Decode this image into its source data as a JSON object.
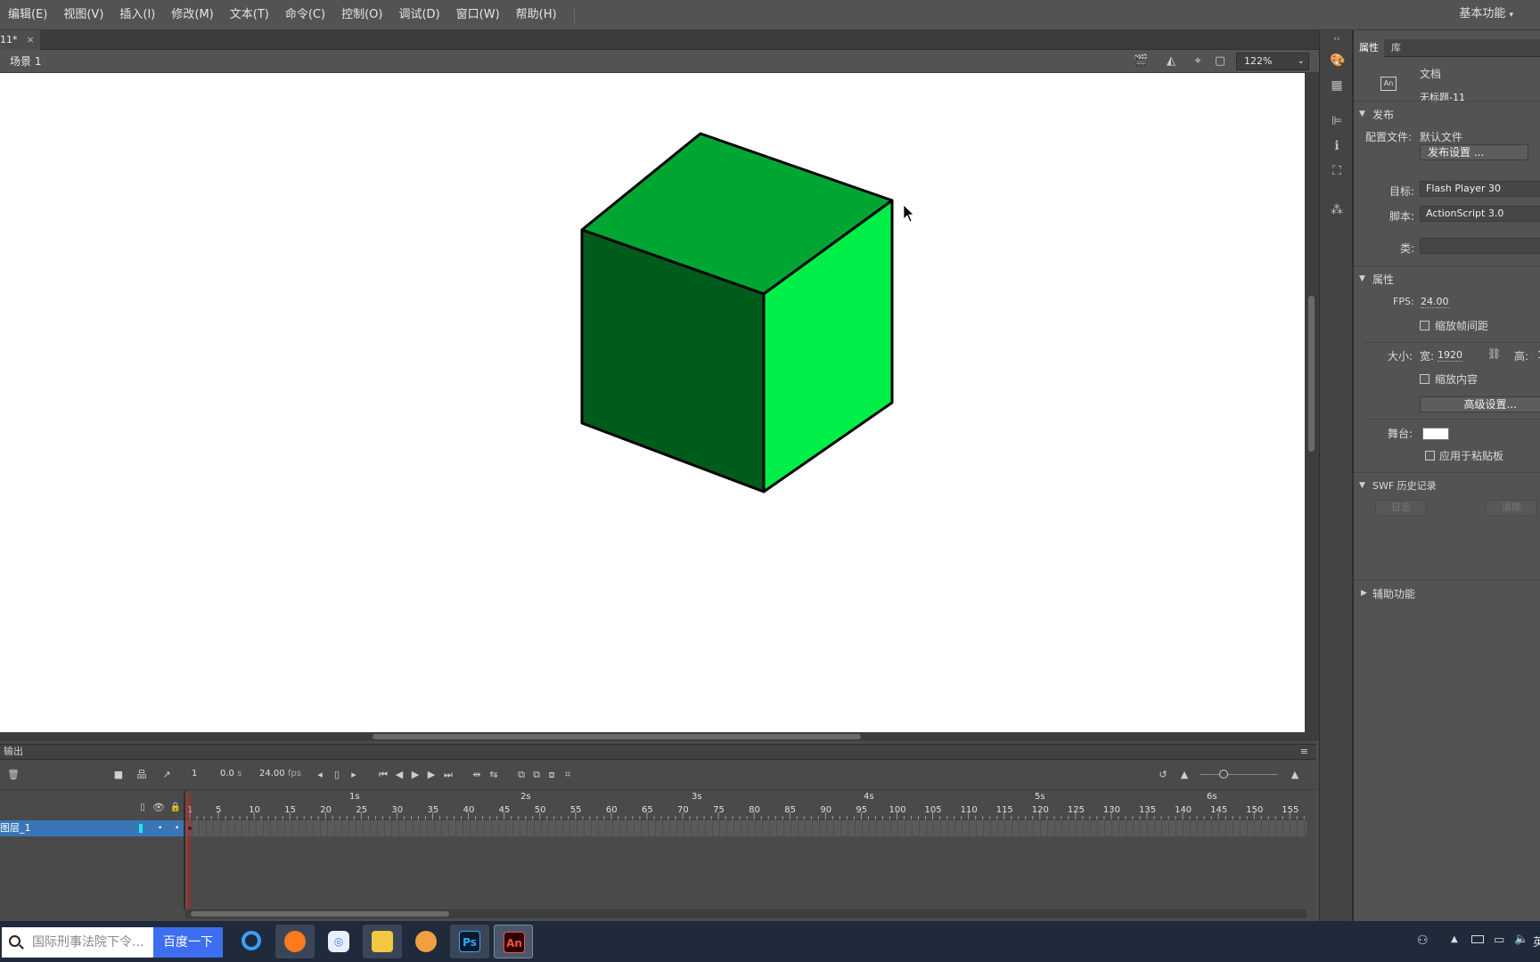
{
  "menu": [
    "编辑(E)",
    "视图(V)",
    "插入(I)",
    "修改(M)",
    "文本(T)",
    "命令(C)",
    "控制(O)",
    "调试(D)",
    "窗口(W)",
    "帮助(H)"
  ],
  "workspace": "基本功能",
  "doc_tab": {
    "title": "11*",
    "close": "×"
  },
  "scene": {
    "label": "场景 1",
    "zoom": "122%"
  },
  "output_label": "输出",
  "timeline": {
    "frame": "1",
    "time": "0.0",
    "time_unit": "s",
    "fps": "24.00",
    "fps_unit": "fps",
    "seconds": [
      "1s",
      "2s",
      "3s",
      "4s",
      "5s",
      "6s"
    ],
    "frame_ticks": [
      "1",
      "5",
      "10",
      "15",
      "20",
      "25",
      "30",
      "35",
      "40",
      "45",
      "50",
      "55",
      "60",
      "65",
      "70",
      "75",
      "80",
      "85",
      "90",
      "95",
      "100",
      "105",
      "110",
      "115",
      "120",
      "125",
      "130",
      "135",
      "140",
      "145",
      "150",
      "155"
    ],
    "layer_name": "图层_1"
  },
  "props": {
    "tab_props": "属性",
    "tab_lib": "库",
    "doc_type": "文档",
    "doc_name": "无标题-11",
    "publish_header": "发布",
    "profile_label": "配置文件:",
    "profile_value": "默认文件",
    "publish_settings_btn": "发布设置 ...",
    "target_label": "目标:",
    "target_value": "Flash Player 30",
    "script_label": "脚本:",
    "script_value": "ActionScript 3.0",
    "class_label": "类:",
    "properties_header": "属性",
    "fps_label": "FPS:",
    "fps_value": "24.00",
    "scale_spans": "缩放帧间距",
    "size_label": "大小:",
    "width_label": "宽:",
    "width_value": "1920",
    "height_label": "高:",
    "height_value": "1",
    "scale_content": "缩放内容",
    "advanced_btn": "高级设置...",
    "stage_label": "舞台:",
    "stage_color": "#ffffff",
    "apply_paste": "应用于粘贴板",
    "swf_header": "SWF 历史记录",
    "log_btn": "日志",
    "clear_btn": "清除",
    "accessibility_header": "辅助功能"
  },
  "taskbar": {
    "search_placeholder": "国际刑事法院下令...",
    "search_button": "百度一下",
    "apps": [
      "edge-app",
      "firefox-app",
      "baidu-netdisk-app",
      "file-explorer-app",
      "qq-app",
      "photoshop-app",
      "animate-app"
    ],
    "ps_label": "Ps",
    "an_label": "An",
    "tray_lang": "英"
  },
  "colors": {
    "cube_top": "#00a632",
    "cube_left": "#005c1a",
    "cube_right": "#00ee48",
    "accent_layer": "#3876b8",
    "playhead": "#d03030"
  }
}
